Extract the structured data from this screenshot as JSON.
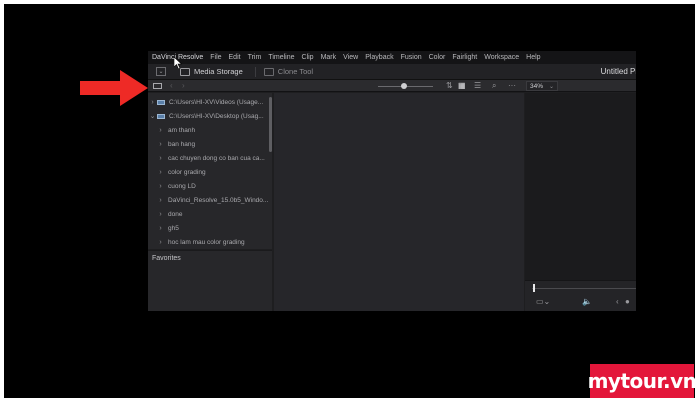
{
  "menubar": {
    "items": [
      "DaVinci Resolve",
      "File",
      "Edit",
      "Trim",
      "Timeline",
      "Clip",
      "Mark",
      "View",
      "Playback",
      "Fusion",
      "Color",
      "Fairlight",
      "Workspace",
      "Help"
    ]
  },
  "toolbar": {
    "media_storage_label": "Media Storage",
    "clone_tool_label": "Clone Tool",
    "project_title": "Untitled Pr"
  },
  "subbar": {
    "zoom_value": "34%"
  },
  "tree": {
    "items": [
      {
        "label": "C:\\Users\\HI-XV\\Videos (Usage...",
        "expanded": false,
        "drive": true
      },
      {
        "label": "C:\\Users\\HI-XV\\Desktop (Usag...",
        "expanded": true,
        "drive": true
      },
      {
        "label": "am thanh",
        "expanded": false,
        "drive": false
      },
      {
        "label": "ban hang",
        "expanded": false,
        "drive": false
      },
      {
        "label": "cac chuyen dong co ban cua ca...",
        "expanded": false,
        "drive": false
      },
      {
        "label": "color grading",
        "expanded": false,
        "drive": false
      },
      {
        "label": "cuong LD",
        "expanded": false,
        "drive": false
      },
      {
        "label": "DaVinci_Resolve_15.0b5_Windo...",
        "expanded": false,
        "drive": false
      },
      {
        "label": "done",
        "expanded": false,
        "drive": false
      },
      {
        "label": "gh5",
        "expanded": false,
        "drive": false
      },
      {
        "label": "hoc lam mau color grading",
        "expanded": false,
        "drive": false
      }
    ]
  },
  "favorites": {
    "label": "Favorites"
  },
  "watermark": {
    "text": "mytour.vn",
    "color": "#e3163a"
  },
  "colors": {
    "annotation_arrow": "#ee2a26",
    "app_background": "#1e1e20"
  }
}
